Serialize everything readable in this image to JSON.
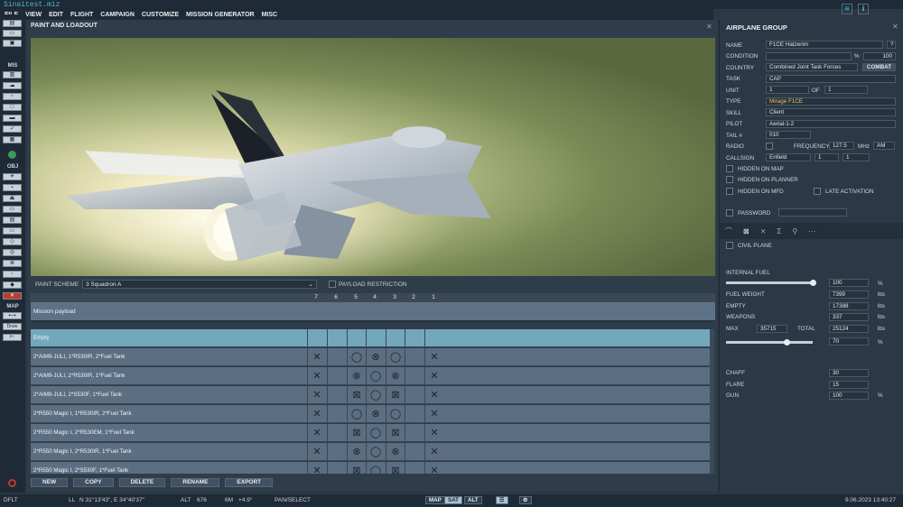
{
  "window": {
    "title": "Sinaitest.miz"
  },
  "menu": [
    "FILE",
    "VIEW",
    "EDIT",
    "FLIGHT",
    "CAMPAIGN",
    "CUSTOMIZE",
    "MISSION GENERATOR",
    "MISC"
  ],
  "toolbar": {
    "mis_label": "MIS",
    "obj_label": "OBJ",
    "map_label": "MAP",
    "draw_label": "Draw"
  },
  "paint": {
    "header": "PAINT AND LOADOUT",
    "scheme_label": "PAINT SCHEME",
    "scheme_value": "3 Squadron A",
    "payload_restriction": "PAYLOAD RESTRICTION"
  },
  "pylons": [
    "7",
    "6",
    "5",
    "4",
    "3",
    "2",
    "1"
  ],
  "mission_payload": "Mission payload",
  "loadouts": [
    {
      "name": "Empty",
      "cells": [
        "",
        "",
        "",
        "",
        "",
        "",
        ""
      ]
    },
    {
      "name": "2*AIM9-JULI, 1*R530IR, 2*Fuel Tank",
      "cells": [
        "✕",
        "",
        "◯",
        "⊗",
        "◯",
        "",
        "✕"
      ]
    },
    {
      "name": "2*AIM9-JULI, 2*R530IR, 1*Fuel Tank",
      "cells": [
        "✕",
        "",
        "⊗",
        "◯",
        "⊗",
        "",
        "✕"
      ]
    },
    {
      "name": "2*AIM9-JULI, 2*S530F, 1*Fuel Tank",
      "cells": [
        "✕",
        "",
        "⊠",
        "◯",
        "⊠",
        "",
        "✕"
      ]
    },
    {
      "name": "2*R550 Magic I, 1*R530IR, 2*Fuel Tank",
      "cells": [
        "✕",
        "",
        "◯",
        "⊗",
        "◯",
        "",
        "✕"
      ]
    },
    {
      "name": "2*R550 Magic I, 2*R530EM, 1*Fuel Tank",
      "cells": [
        "✕",
        "",
        "⊠",
        "◯",
        "⊠",
        "",
        "✕"
      ]
    },
    {
      "name": "2*R550 Magic I, 2*R530IR, 1*Fuel Tank",
      "cells": [
        "✕",
        "",
        "⊗",
        "◯",
        "⊗",
        "",
        "✕"
      ]
    },
    {
      "name": "2*R550 Magic I, 2*S530F, 1*Fuel Tank",
      "cells": [
        "✕",
        "",
        "⊠",
        "◯",
        "⊠",
        "",
        "✕"
      ]
    }
  ],
  "buttons": {
    "new": "NEW",
    "copy": "COPY",
    "delete": "DELETE",
    "rename": "RENAME",
    "export": "EXPORT"
  },
  "group": {
    "header": "AIRPLANE GROUP",
    "help": "?",
    "name_label": "NAME",
    "name": "F1CE Hatzerim",
    "condition_label": "CONDITION",
    "condition_unit": "%",
    "condition_value": "100",
    "country_label": "COUNTRY",
    "country": "Combined Joint Task Forces",
    "combat": "COMBAT",
    "task_label": "TASK",
    "task": "CAP",
    "unit_label": "UNIT",
    "unit": "1",
    "of_label": "OF",
    "unit_of": "1",
    "type_label": "TYPE",
    "type": "Mirage F1CE",
    "skill_label": "SKILL",
    "skill": "Client",
    "pilot_label": "PILOT",
    "pilot": "Aerial-1-2",
    "tail_label": "TAIL #",
    "tail": "010",
    "radio_label": "RADIO",
    "frequency_label": "FREQUENCY",
    "frequency": "127.5",
    "mhz": "MHz",
    "am": "AM",
    "callsign_label": "CALLSIGN",
    "callsign": "Enfield",
    "callsign_n1": "1",
    "callsign_n2": "1",
    "hidden_map": "HIDDEN ON MAP",
    "hidden_planner": "HIDDEN ON PLANNER",
    "hidden_mfd": "HIDDEN ON MFD",
    "late_activation": "LATE ACTIVATION",
    "password_label": "PASSWORD",
    "civil_plane": "CIVIL PLANE",
    "internal_fuel_label": "INTERNAL FUEL",
    "internal_fuel": "100",
    "pct": "%",
    "fuel_weight_label": "FUEL WEIGHT",
    "fuel_weight": "7399",
    "lbs": "lbs",
    "empty_label": "EMPTY",
    "empty": "17388",
    "weapons_label": "WEAPONS",
    "weapons": "337",
    "max_label": "MAX",
    "max": "35715",
    "total_label": "TOTAL",
    "total": "25124",
    "slider2_value": "70",
    "chaff_label": "CHAFF",
    "chaff": "30",
    "flare_label": "FLARE",
    "flare": "15",
    "gun_label": "GUN",
    "gun": "100"
  },
  "status": {
    "dflt": "DFLT",
    "ll_label": "LL",
    "ll": "N 31°13'43\", E 34°40'37\"",
    "alt_label": "ALT",
    "alt": "676",
    "wind_label": "6M",
    "wind": "+4.9°",
    "mode": "PAN/SELECT",
    "map": "MAP",
    "sat": "SAT",
    "altbtn": "ALT",
    "datetime": "9.06.2023 13:40:27"
  }
}
